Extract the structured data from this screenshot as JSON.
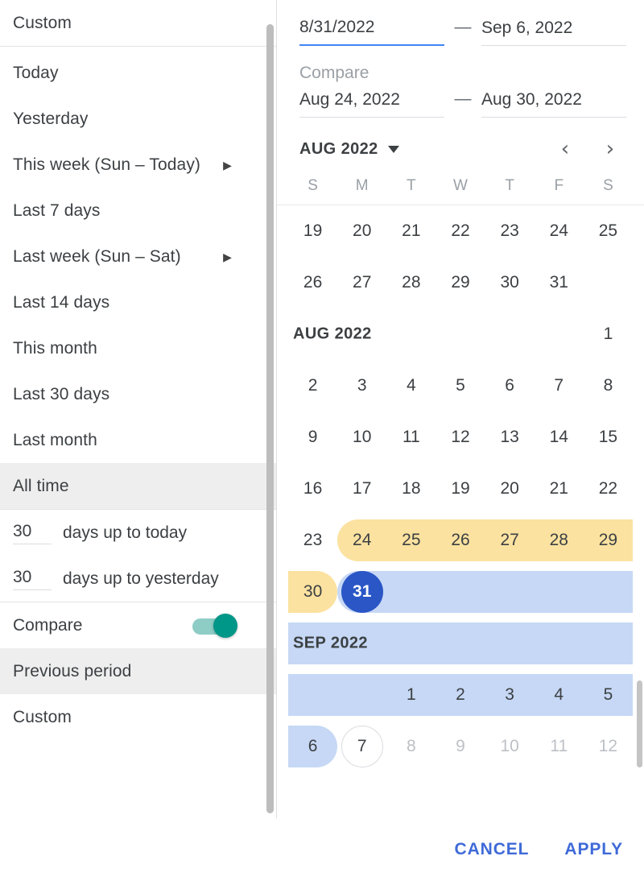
{
  "sidebar": {
    "custom_top": "Custom",
    "presets": [
      {
        "label": "Today",
        "has_submenu": false,
        "selected": false
      },
      {
        "label": "Yesterday",
        "has_submenu": false,
        "selected": false
      },
      {
        "label": "This week (Sun – Today)",
        "has_submenu": true,
        "selected": false
      },
      {
        "label": "Last 7 days",
        "has_submenu": false,
        "selected": false
      },
      {
        "label": "Last week (Sun – Sat)",
        "has_submenu": true,
        "selected": false
      },
      {
        "label": "Last 14 days",
        "has_submenu": false,
        "selected": false
      },
      {
        "label": "This month",
        "has_submenu": false,
        "selected": false
      },
      {
        "label": "Last 30 days",
        "has_submenu": false,
        "selected": false
      },
      {
        "label": "Last month",
        "has_submenu": false,
        "selected": false
      },
      {
        "label": "All time",
        "has_submenu": false,
        "selected": true
      }
    ],
    "days_rows": [
      {
        "value": "30",
        "label": "days up to today"
      },
      {
        "value": "30",
        "label": "days up to yesterday"
      }
    ],
    "compare": {
      "label": "Compare",
      "enabled": true,
      "toggle_color": "#009688",
      "track_color": "#8ecdc6"
    },
    "compare_options": [
      {
        "label": "Previous period",
        "selected": true
      },
      {
        "label": "Custom",
        "selected": false
      }
    ],
    "submenu_arrow_icon": "▶"
  },
  "range": {
    "start_value": "8/31/2022",
    "end_value": "Sep 6, 2022",
    "dash": "—",
    "start_focused": true,
    "focus_color": "#4285f4"
  },
  "compare_range": {
    "title": "Compare",
    "start_value": "Aug 24, 2022",
    "end_value": "Aug 30, 2022",
    "dash": "—"
  },
  "calendar": {
    "header_month": "AUG 2022",
    "dropdown_icon": "caret-down-icon",
    "prev_icon": "‹",
    "next_icon": "›",
    "dow": [
      "S",
      "M",
      "T",
      "W",
      "T",
      "F",
      "S"
    ],
    "selection_color": "#2a56c6",
    "selection_band_color": "#c6d8f5",
    "compare_band_color": "#fbe2a0",
    "rows": [
      {
        "type": "week",
        "cells": [
          {
            "d": "19"
          },
          {
            "d": "20"
          },
          {
            "d": "21"
          },
          {
            "d": "22"
          },
          {
            "d": "23"
          },
          {
            "d": "24"
          },
          {
            "d": "25"
          }
        ]
      },
      {
        "type": "week",
        "cells": [
          {
            "d": "26"
          },
          {
            "d": "27"
          },
          {
            "d": "28"
          },
          {
            "d": "29"
          },
          {
            "d": "30"
          },
          {
            "d": "31"
          },
          {
            "d": ""
          }
        ]
      },
      {
        "type": "month",
        "label": "AUG 2022",
        "cells": [
          {
            "d": ""
          },
          {
            "d": ""
          },
          {
            "d": ""
          },
          {
            "d": ""
          },
          {
            "d": ""
          },
          {
            "d": ""
          },
          {
            "d": "1"
          }
        ]
      },
      {
        "type": "week",
        "cells": [
          {
            "d": "2"
          },
          {
            "d": "3"
          },
          {
            "d": "4"
          },
          {
            "d": "5"
          },
          {
            "d": "6"
          },
          {
            "d": "7"
          },
          {
            "d": "8"
          }
        ]
      },
      {
        "type": "week",
        "cells": [
          {
            "d": "9"
          },
          {
            "d": "10"
          },
          {
            "d": "11"
          },
          {
            "d": "12"
          },
          {
            "d": "13"
          },
          {
            "d": "14"
          },
          {
            "d": "15"
          }
        ]
      },
      {
        "type": "week",
        "cells": [
          {
            "d": "16"
          },
          {
            "d": "17"
          },
          {
            "d": "18"
          },
          {
            "d": "19"
          },
          {
            "d": "20"
          },
          {
            "d": "21"
          },
          {
            "d": "22"
          }
        ]
      },
      {
        "type": "week",
        "cells": [
          {
            "d": "23"
          },
          {
            "d": "24",
            "band": "yellow",
            "band_start": true
          },
          {
            "d": "25",
            "band": "yellow"
          },
          {
            "d": "26",
            "band": "yellow"
          },
          {
            "d": "27",
            "band": "yellow"
          },
          {
            "d": "28",
            "band": "yellow"
          },
          {
            "d": "29",
            "band": "yellow"
          }
        ]
      },
      {
        "type": "week",
        "cells": [
          {
            "d": "30",
            "band": "yellow",
            "band_end": true
          },
          {
            "d": "31",
            "band": "blue",
            "band_start": true,
            "selected": true
          },
          {
            "d": "",
            "band": "blue"
          },
          {
            "d": "",
            "band": "blue"
          },
          {
            "d": "",
            "band": "blue"
          },
          {
            "d": "",
            "band": "blue"
          },
          {
            "d": "",
            "band": "blue"
          }
        ]
      },
      {
        "type": "month",
        "label": "SEP 2022",
        "cells": [
          {
            "d": "",
            "band": "blue"
          },
          {
            "d": "",
            "band": "blue"
          },
          {
            "d": "",
            "band": "blue"
          },
          {
            "d": "",
            "band": "blue"
          },
          {
            "d": "",
            "band": "blue"
          },
          {
            "d": "",
            "band": "blue"
          },
          {
            "d": "",
            "band": "blue"
          }
        ]
      },
      {
        "type": "week",
        "cells": [
          {
            "d": "",
            "band": "blue"
          },
          {
            "d": "",
            "band": "blue"
          },
          {
            "d": "1",
            "band": "blue"
          },
          {
            "d": "2",
            "band": "blue"
          },
          {
            "d": "3",
            "band": "blue"
          },
          {
            "d": "4",
            "band": "blue"
          },
          {
            "d": "5",
            "band": "blue"
          }
        ]
      },
      {
        "type": "week",
        "cells": [
          {
            "d": "6",
            "band": "blue",
            "band_end": true
          },
          {
            "d": "7",
            "today": true
          },
          {
            "d": "8",
            "muted": true
          },
          {
            "d": "9",
            "muted": true
          },
          {
            "d": "10",
            "muted": true
          },
          {
            "d": "11",
            "muted": true
          },
          {
            "d": "12",
            "muted": true
          }
        ]
      }
    ]
  },
  "footer": {
    "cancel_label": "CANCEL",
    "apply_label": "APPLY",
    "action_color": "#3f6ad8"
  }
}
